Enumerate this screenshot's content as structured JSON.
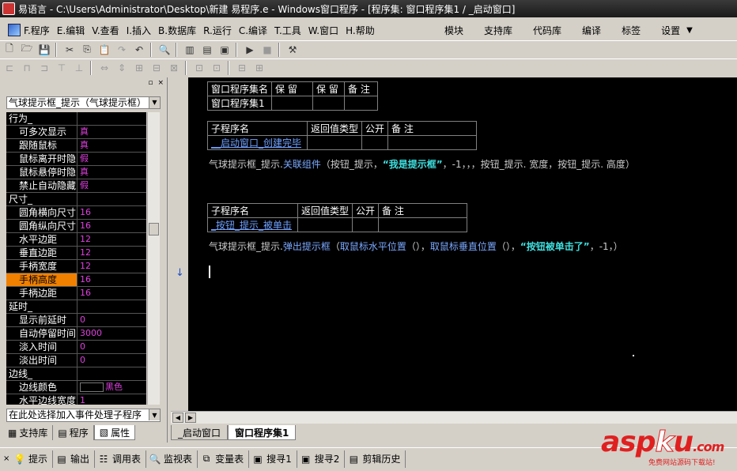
{
  "window": {
    "title": "易语言 - C:\\Users\\Administrator\\Desktop\\新建 易程序.e - Windows窗口程序 - [程序集: 窗口程序集1 / _启动窗口]"
  },
  "menu": {
    "items": [
      "F.程序",
      "E.编辑",
      "V.查看",
      "I.插入",
      "B.数据库",
      "R.运行",
      "C.编译",
      "T.工具",
      "W.窗口",
      "H.帮助"
    ],
    "right": [
      "模块",
      "支持库",
      "代码库",
      "编译",
      "标签",
      "设置"
    ],
    "dropdown_glyph": "▼"
  },
  "left_panel": {
    "top_glyphs": [
      "▫",
      "×"
    ],
    "component_select": "气球提示框_提示（气球提示框）",
    "properties": [
      {
        "name": "行为_",
        "value": "",
        "group": true
      },
      {
        "name": "可多次显示",
        "value": "真"
      },
      {
        "name": "跟随鼠标",
        "value": "真"
      },
      {
        "name": "鼠标离开时隐",
        "value": "假"
      },
      {
        "name": "鼠标悬停时隐",
        "value": "真"
      },
      {
        "name": "禁止自动隐藏",
        "value": "假"
      },
      {
        "name": "尺寸_",
        "value": "",
        "group": true
      },
      {
        "name": "圆角横向尺寸",
        "value": "16"
      },
      {
        "name": "圆角纵向尺寸",
        "value": "16"
      },
      {
        "name": "水平边距",
        "value": "12"
      },
      {
        "name": "垂直边距",
        "value": "12"
      },
      {
        "name": "手柄宽度",
        "value": "12"
      },
      {
        "name": "手柄高度",
        "value": "16",
        "selected": true
      },
      {
        "name": "手柄边距",
        "value": "16"
      },
      {
        "name": "延时_",
        "value": "",
        "group": true
      },
      {
        "name": "显示前延时",
        "value": "0"
      },
      {
        "name": "自动停留时间",
        "value": "3000"
      },
      {
        "name": "淡入时间",
        "value": "0"
      },
      {
        "name": "淡出时间",
        "value": "0"
      },
      {
        "name": "边线_",
        "value": "",
        "group": true
      },
      {
        "name": "边线颜色",
        "value": "黑色",
        "color": true
      },
      {
        "name": "水平边线宽度",
        "value": "1"
      }
    ],
    "event_select": "在此处选择加入事件处理子程序",
    "tabs": [
      {
        "label": "支持库",
        "icon": "library-icon"
      },
      {
        "label": "程序",
        "icon": "program-icon"
      },
      {
        "label": "属性",
        "icon": "property-icon",
        "active": true
      }
    ]
  },
  "editor": {
    "assembly_table": {
      "headers": [
        "窗口程序集名",
        "保 留",
        "保 留",
        "备 注"
      ],
      "row": [
        "窗口程序集1",
        "",
        "",
        ""
      ]
    },
    "sub1": {
      "headers": [
        "子程序名",
        "返回值类型",
        "公开",
        "备 注"
      ],
      "row": [
        "__启动窗口_创建完毕",
        "",
        "",
        ""
      ]
    },
    "code1": {
      "obj": "气球提示框_提示.",
      "fn": "关联组件",
      "args_a": "（按钮_提示，",
      "str": "“我是提示框”",
      "args_b": "，-1，，，按钮_提示. 宽度，按钮_提示. 高度）"
    },
    "sub2": {
      "headers": [
        "子程序名",
        "返回值类型",
        "公开",
        "备 注"
      ],
      "row": [
        "_按钮_提示_被单击",
        "",
        "",
        ""
      ]
    },
    "code2": {
      "obj": "气球提示框_提示.",
      "fn": "弹出提示框",
      "args_a": "（",
      "fn2": "取鼠标水平位置",
      "args_b": "（），",
      "fn3": "取鼠标垂直位置",
      "args_c": "（），",
      "str": "“按钮被单击了”",
      "args_d": "，-1，）"
    },
    "gutter_arrow": "↓"
  },
  "doc_tabs": [
    {
      "label": "_启动窗口",
      "active": false
    },
    {
      "label": "窗口程序集1",
      "active": true
    }
  ],
  "bottom_tabs": [
    {
      "label": "提示",
      "icon": "hint-icon",
      "glyph": "💡"
    },
    {
      "label": "输出",
      "icon": "output-icon",
      "glyph": "▤"
    },
    {
      "label": "调用表",
      "icon": "callstack-icon",
      "glyph": "☷"
    },
    {
      "label": "监视表",
      "icon": "watch-icon",
      "glyph": "🔍"
    },
    {
      "label": "变量表",
      "icon": "variables-icon",
      "glyph": "⧉"
    },
    {
      "label": "搜寻1",
      "icon": "search1-icon",
      "glyph": "▣"
    },
    {
      "label": "搜寻2",
      "icon": "search2-icon",
      "glyph": "▣"
    },
    {
      "label": "剪辑历史",
      "icon": "clip-history-icon",
      "glyph": "▤"
    }
  ],
  "watermark": {
    "brand_a": "asp",
    "brand_k": "k",
    "brand_b": "u",
    "brand_c": ".com",
    "tagline": "免费网站源码下载站!"
  }
}
